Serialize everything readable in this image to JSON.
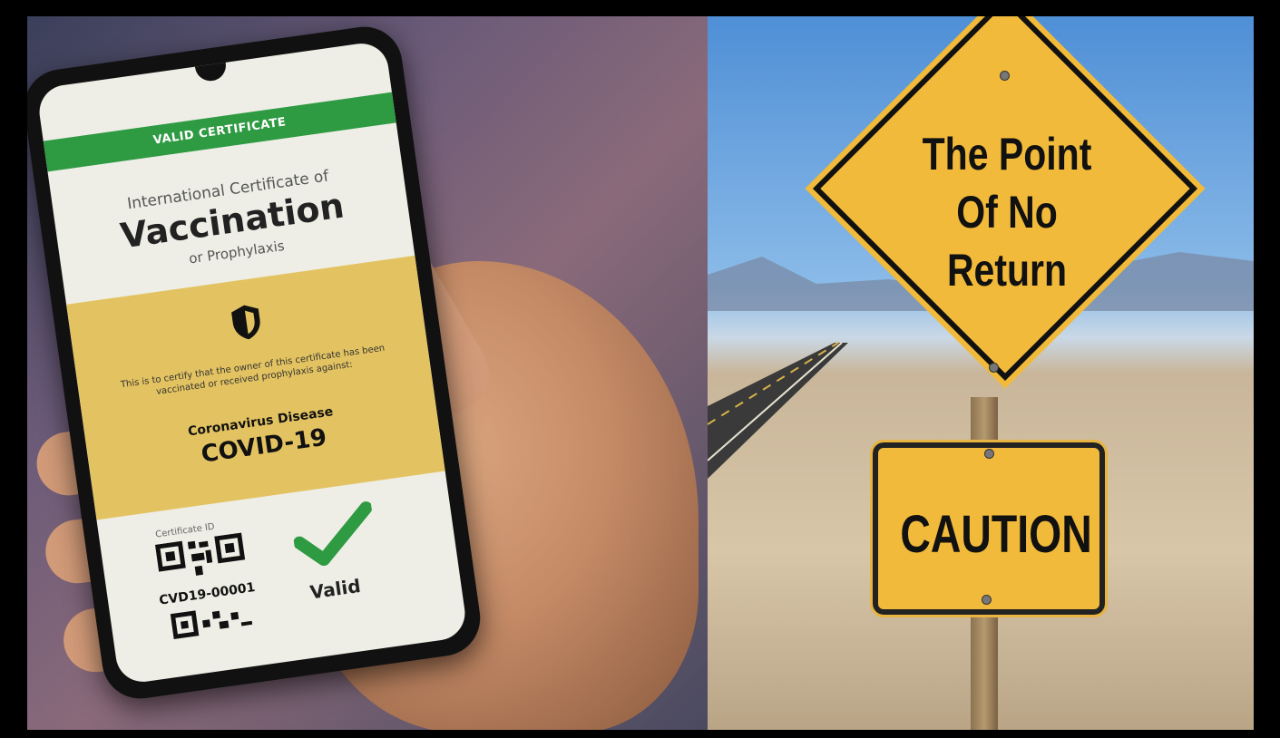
{
  "left_image": {
    "certificate": {
      "banner": "VALID CERTIFICATE",
      "title_small": "International Certificate of",
      "title_large": "Vaccination",
      "title_sub": "or Prophylaxis",
      "certify_text": "This is to certify that the owner of this certificate has been vaccinated or received prophylaxis against:",
      "disease_name": "Coronavirus Disease",
      "disease_code": "COVID-19",
      "certificate_id_label": "Certificate ID",
      "certificate_id": "CVD19-00001",
      "status": "Valid"
    },
    "colors": {
      "banner": "#2e9a42",
      "panel": "#e3c361",
      "check": "#2e9a42"
    }
  },
  "right_image": {
    "diamond_sign": "The Point Of No Return",
    "diamond_lines": [
      "The Point",
      "Of No",
      "Return"
    ],
    "caution_sign": "CAUTION",
    "colors": {
      "sign": "#f2ba3a"
    }
  }
}
